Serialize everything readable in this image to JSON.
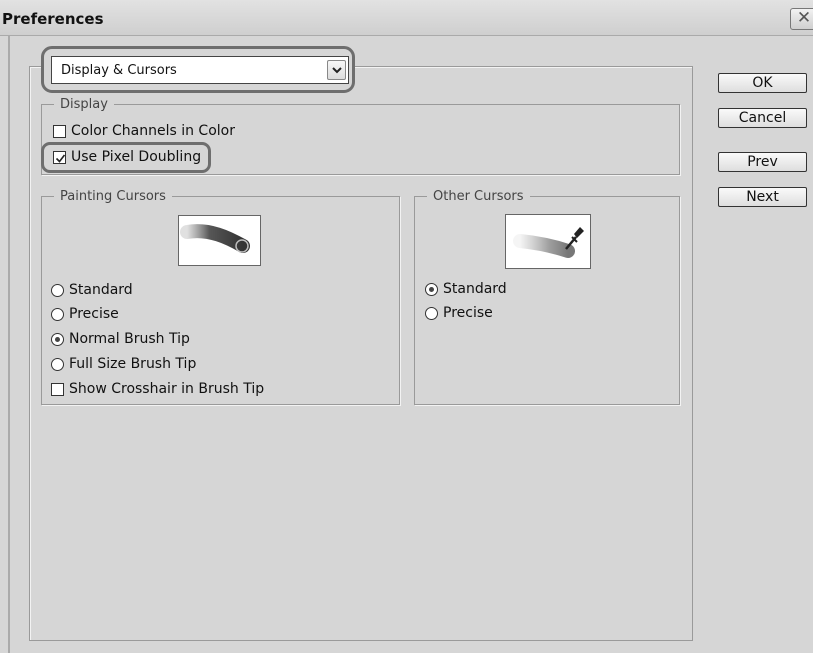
{
  "window": {
    "title": "Preferences",
    "close_glyph": "✕"
  },
  "category": {
    "selected": "Display & Cursors"
  },
  "display": {
    "legend": "Display",
    "color_channels": {
      "label": "Color Channels in Color",
      "checked": false
    },
    "pixel_doubling": {
      "label": "Use Pixel Doubling",
      "checked": true
    }
  },
  "painting_cursors": {
    "legend": "Painting Cursors",
    "options": [
      "Standard",
      "Precise",
      "Normal Brush Tip",
      "Full Size Brush Tip"
    ],
    "selected": "Normal Brush Tip",
    "crosshair": {
      "label": "Show Crosshair in Brush Tip",
      "checked": false
    }
  },
  "other_cursors": {
    "legend": "Other Cursors",
    "options": [
      "Standard",
      "Precise"
    ],
    "selected": "Standard"
  },
  "buttons": {
    "ok": "OK",
    "cancel": "Cancel",
    "prev": "Prev",
    "next": "Next"
  },
  "icons": {
    "dropdown": "chevron-down-icon",
    "brush_preview": "brush-tip-cursor-icon",
    "eyedropper_preview": "eyedropper-icon",
    "close": "close-icon"
  }
}
